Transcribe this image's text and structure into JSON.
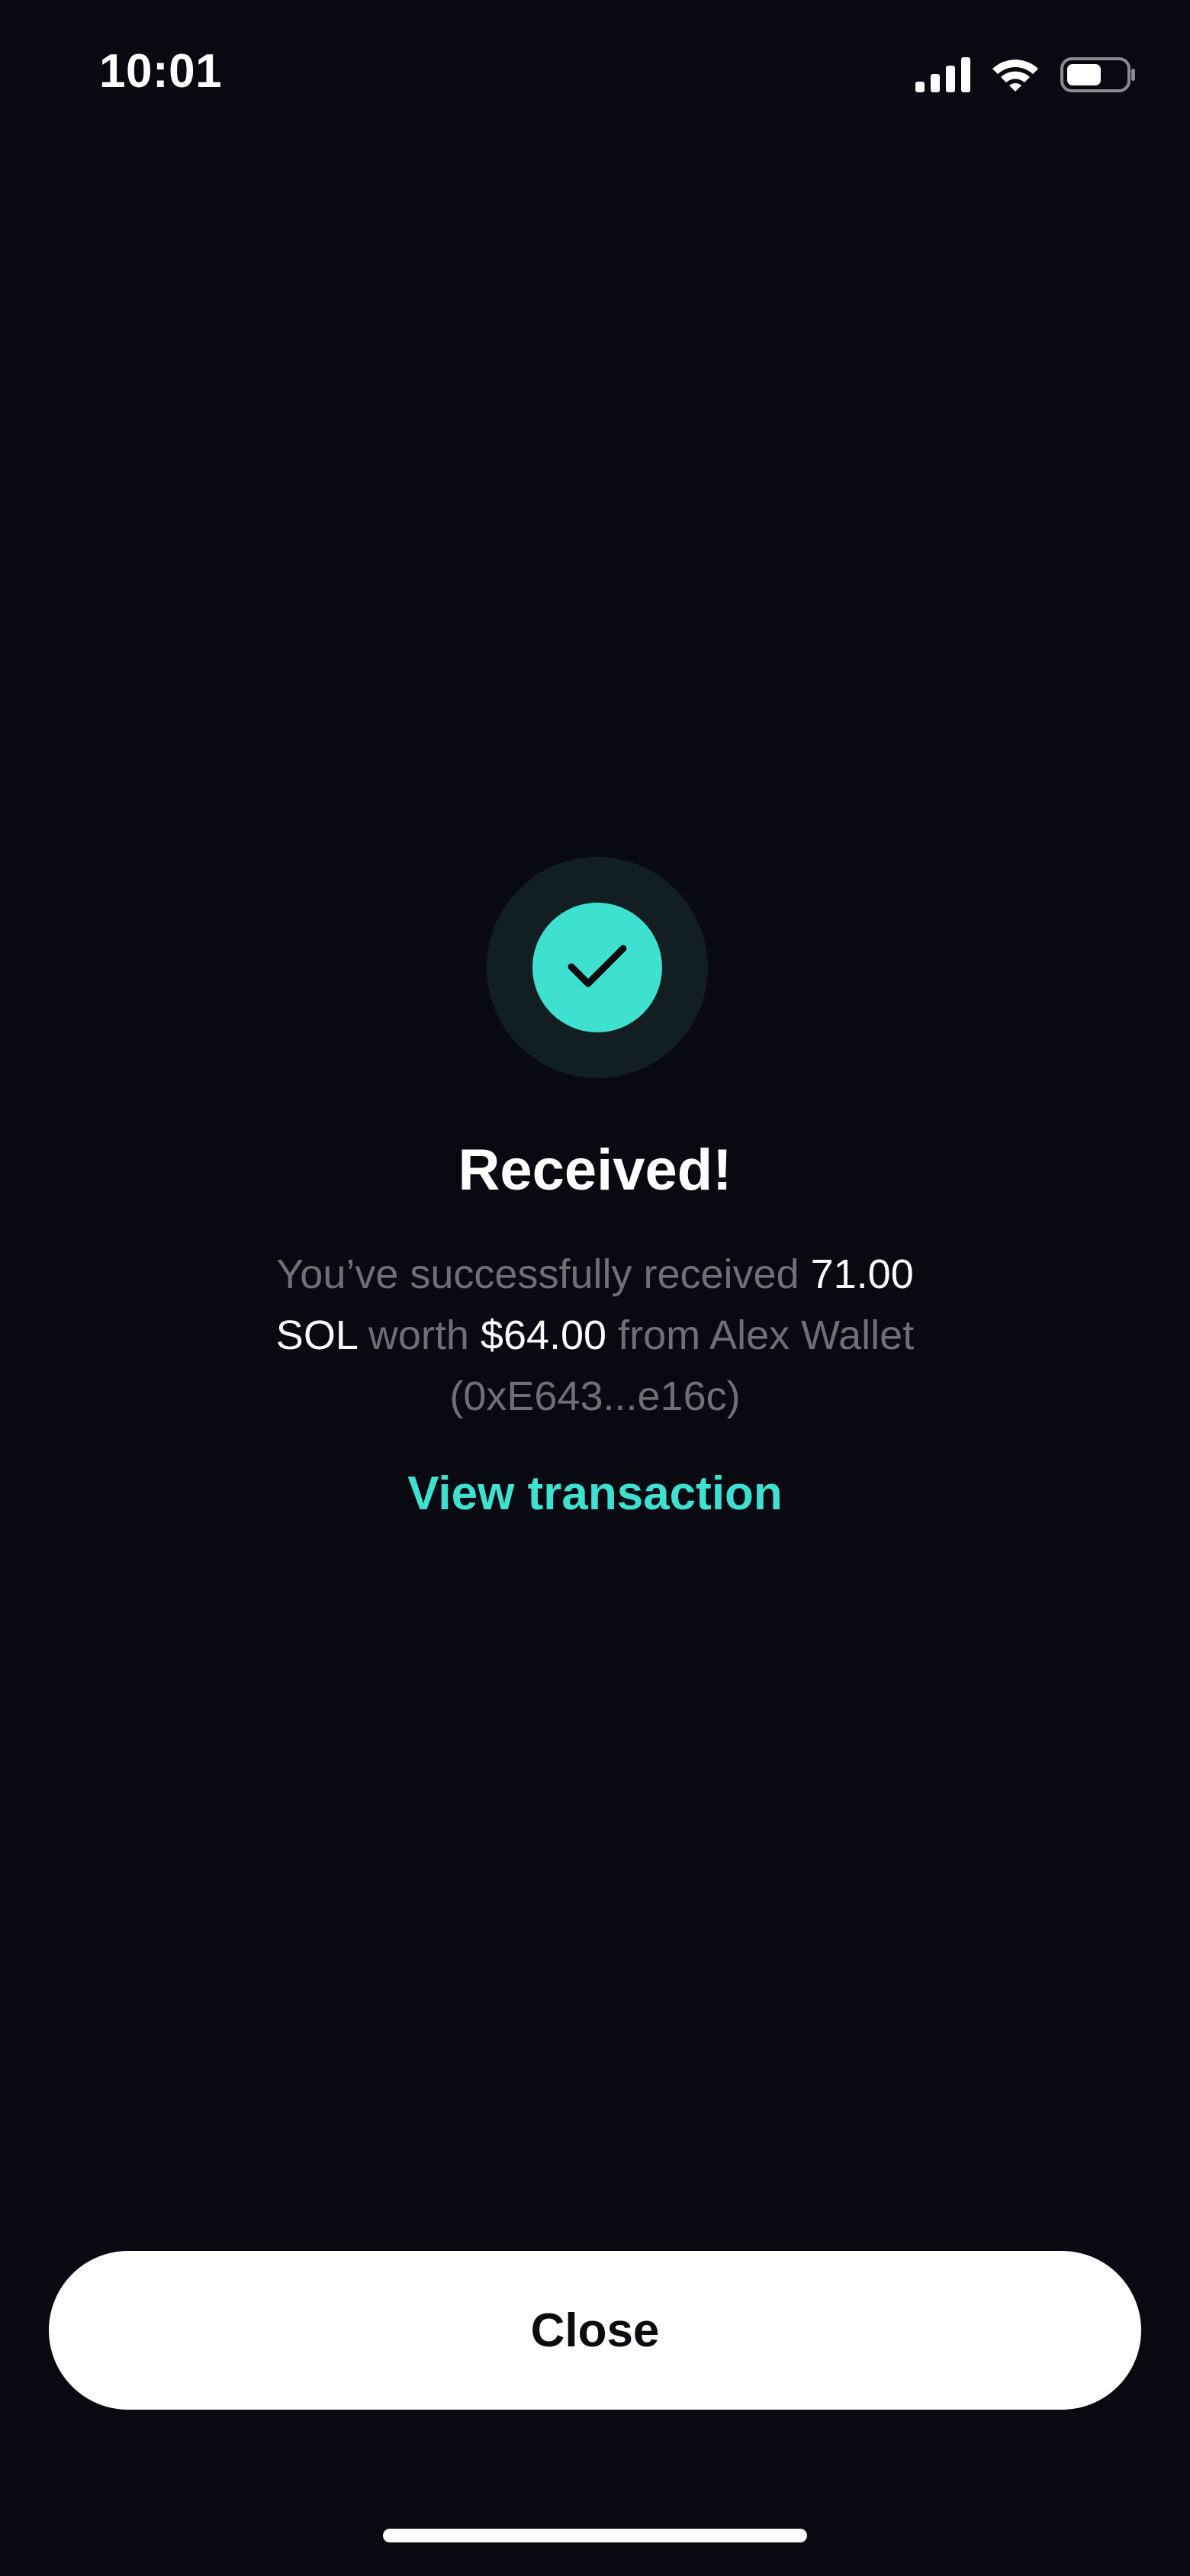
{
  "status_bar": {
    "time": "10:01",
    "icons": [
      "cellular-signal-icon",
      "wifi-icon",
      "battery-icon"
    ],
    "battery_level": 0.6
  },
  "badge": {
    "icon": "checkmark-icon",
    "outer_color": "#121f22",
    "inner_color": "#3ee0cf"
  },
  "receipt": {
    "title": "Received!",
    "message": {
      "prefix": "You’ve successfully received ",
      "amount": "71.00 SOL",
      "worth_label": " worth ",
      "value": "$64.00",
      "from_label": " from Alex Wallet (0xE643...e16c)"
    },
    "view_transaction_label": "View transaction"
  },
  "actions": {
    "close_label": "Close"
  },
  "colors": {
    "background": "#080911",
    "accent": "#3ee0cf",
    "muted_text": "#6f7077",
    "primary_text": "#ffffff"
  }
}
